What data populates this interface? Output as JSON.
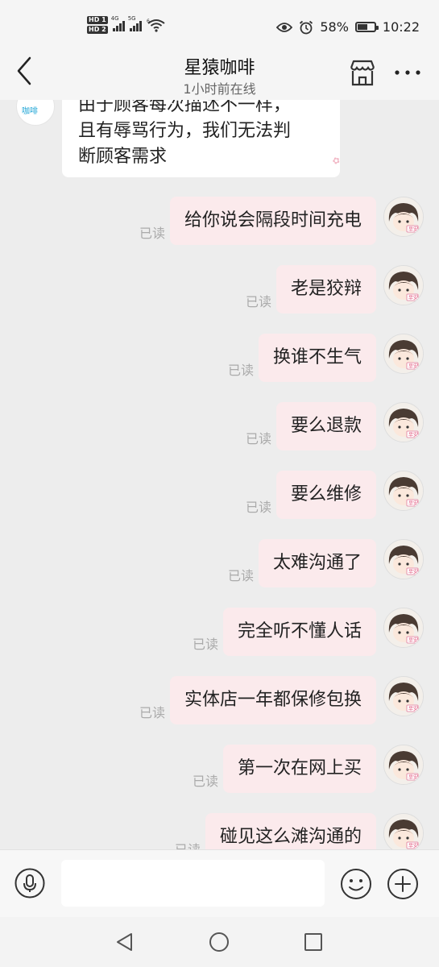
{
  "status_bar": {
    "hd1": "HD 1",
    "hd2": "HD 2",
    "net1": "4G",
    "net2": "5G",
    "wifi_badge": "6",
    "battery_percent": "58%",
    "battery_level": 0.58,
    "time": "10:22"
  },
  "header": {
    "title": "星猿咖啡",
    "subtitle": "1小时前在线"
  },
  "incoming": {
    "avatar_text": "咖啡",
    "lines": [
      "由于顾客每次描述不一样，",
      "且有辱骂行为，我们无法判",
      "断顾客需求"
    ]
  },
  "messages": [
    {
      "text": "给你说会隔段时间充电",
      "status": "已读"
    },
    {
      "text": "老是狡辩",
      "status": "已读"
    },
    {
      "text": "换谁不生气",
      "status": "已读"
    },
    {
      "text": "要么退款",
      "status": "已读"
    },
    {
      "text": "要么维修",
      "status": "已读"
    },
    {
      "text": "太难沟通了",
      "status": "已读"
    },
    {
      "text": "完全听不懂人话",
      "status": "已读"
    },
    {
      "text": "实体店一年都保修包换",
      "status": "已读"
    },
    {
      "text": "第一次在网上买",
      "status": "已读"
    },
    {
      "text": "碰见这么滩沟通的",
      "status": "已读"
    }
  ],
  "input": {
    "placeholder": ""
  },
  "colors": {
    "outgoing_bubble": "#fbeaec",
    "incoming_bubble": "#ffffff",
    "background": "#ededed"
  },
  "icons": {
    "back": "chevron-left-icon",
    "shop": "store-icon",
    "more": "more-icon",
    "voice": "microphone-icon",
    "emoji": "smiley-icon",
    "plus": "plus-icon"
  }
}
